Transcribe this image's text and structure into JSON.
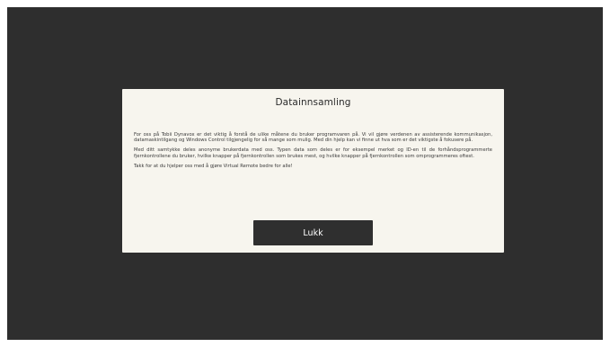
{
  "dialog": {
    "title": "Datainnsamling",
    "paragraphs": [
      "For oss på Tobii Dynavox er det viktig å forstå de ulike måtene du bruker programvaren på.  Vi vil gjøre verdenen av assisterende kommunikasjon, datamaskintilgang og Windows Control tilgjengelig for så mange som mulig. Med din hjelp kan vi finne ut hva som er det viktigste å fokusere på.",
      "Med ditt samtykke deles anonyme brukerdata med oss. Typen data som deles er for eksempel merket og ID-en til de forhåndsprogrammerte fjernkontrollene du bruker, hvilke knapper på fjernkontrollen som brukes mest, og hvilke knapper på fjernkontrollen som omprogrammeres oftest.",
      "Takk for at du hjelper oss med å gjøre Virtual Remote bedre for alle!"
    ],
    "close_label": "Lukk"
  },
  "colors": {
    "backdrop": "#2e2e2e",
    "dialog_background": "#f7f5ee",
    "button_background": "#2f2f2f",
    "button_text": "#ffffff"
  }
}
